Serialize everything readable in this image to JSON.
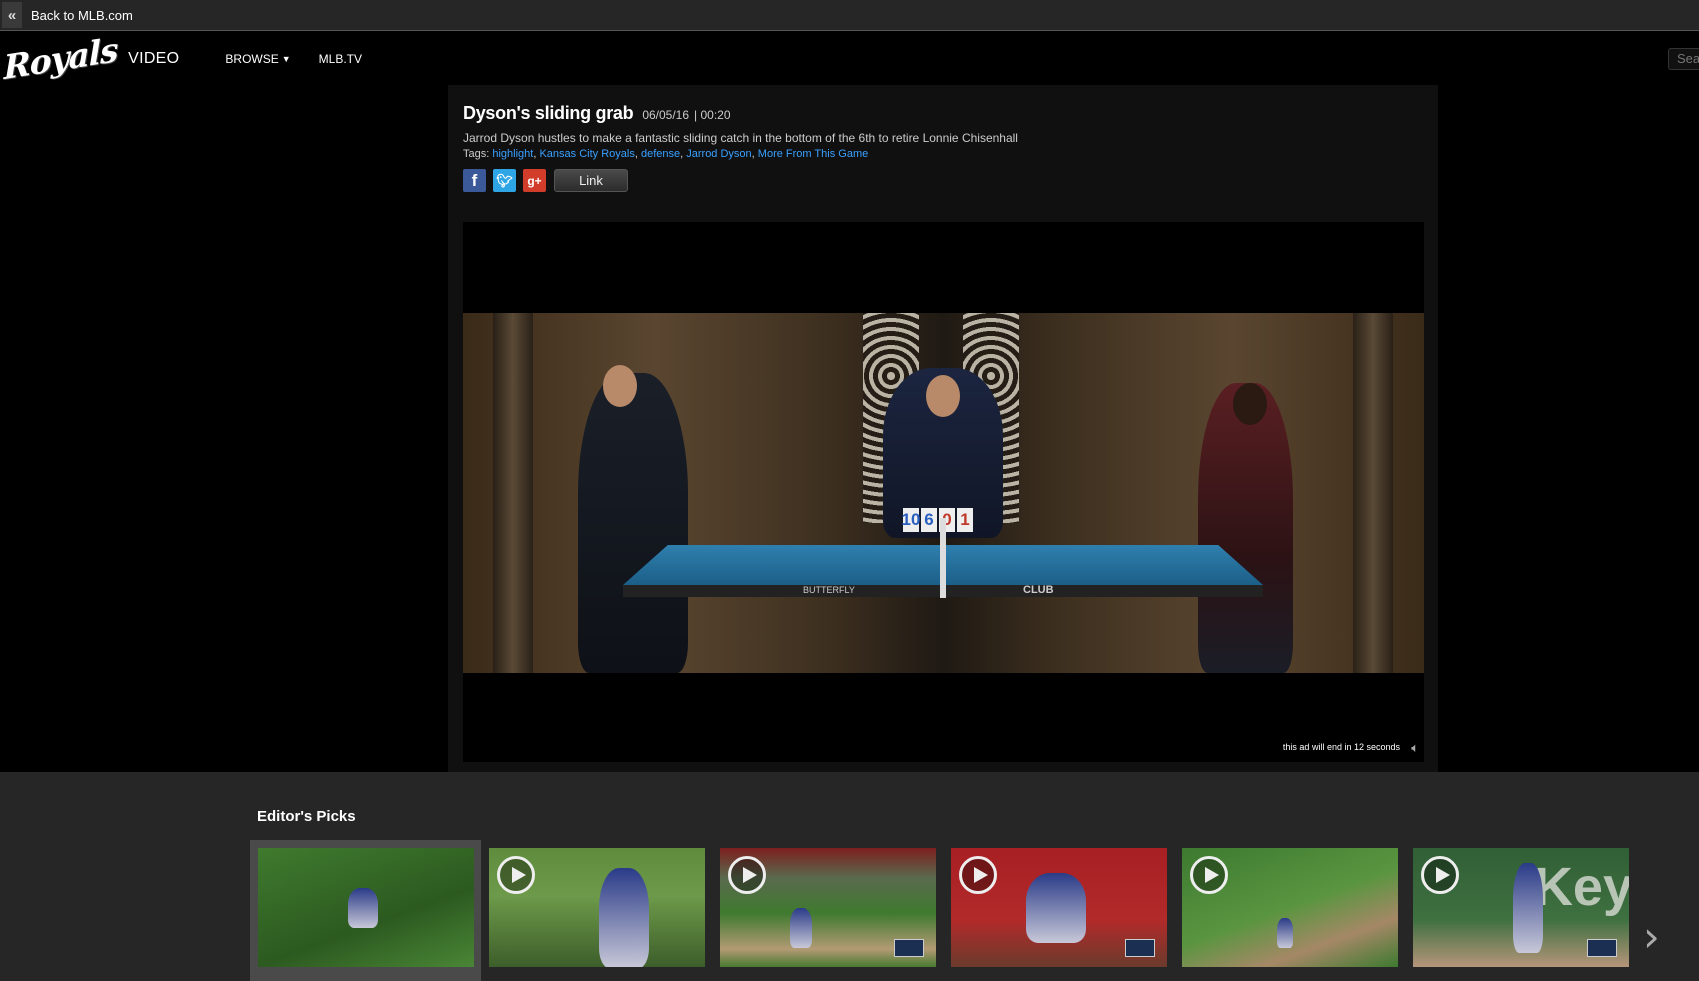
{
  "topbar": {
    "back_label": "Back to MLB.com"
  },
  "nav": {
    "logo_text": "Royals",
    "section": "VIDEO",
    "browse": "BROWSE",
    "mlbtv": "MLB.TV",
    "search_placeholder": "Sea"
  },
  "video_info": {
    "title": "Dyson's sliding grab",
    "date": "06/05/16",
    "duration": "| 00:20",
    "description": "Jarrod Dyson hustles to make a fantastic sliding catch in the bottom of the 6th to retire Lonnie Chisenhall",
    "tags_label": "Tags:",
    "tags": [
      "highlight",
      "Kansas City Royals",
      "defense",
      "Jarrod Dyson",
      "More From This Game"
    ],
    "link_label": "Link"
  },
  "player": {
    "ad_text": "this ad will end in 12 seconds",
    "scoreboard": [
      "10",
      "6",
      "0",
      "1"
    ],
    "table_brand": "BUTTERFLY",
    "table_label": "CLUB"
  },
  "picks": {
    "title": "Editor's Picks",
    "thumbnail_text": "Key"
  },
  "colors": {
    "link": "#3aa0ff",
    "facebook": "#3b5998",
    "twitter": "#2ea6e6",
    "google": "#d23c2a"
  }
}
